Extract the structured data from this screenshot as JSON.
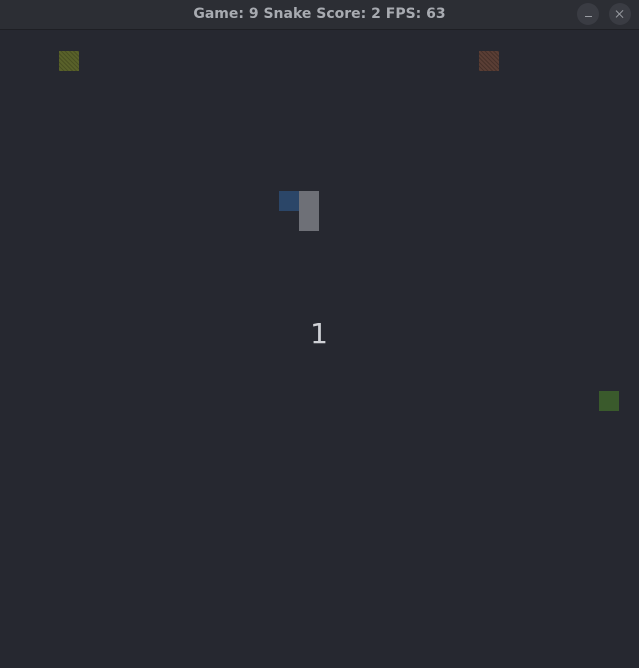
{
  "window": {
    "title": "Game: 9 Snake Score: 2 FPS: 63"
  },
  "game": {
    "countdown": "1",
    "entities": [
      {
        "name": "food-yellow",
        "color": "#59612a"
      },
      {
        "name": "food-red",
        "color": "#5a3e35"
      },
      {
        "name": "food-green",
        "color": "#3a5a2c"
      },
      {
        "name": "snake-head",
        "color": "#2b4668"
      },
      {
        "name": "snake-body",
        "color": "#6e7077"
      }
    ]
  },
  "icons": {
    "minimize": "minimize-icon",
    "close": "close-icon"
  },
  "colors": {
    "background": "#262830",
    "titlebar": "#2c2e34"
  }
}
